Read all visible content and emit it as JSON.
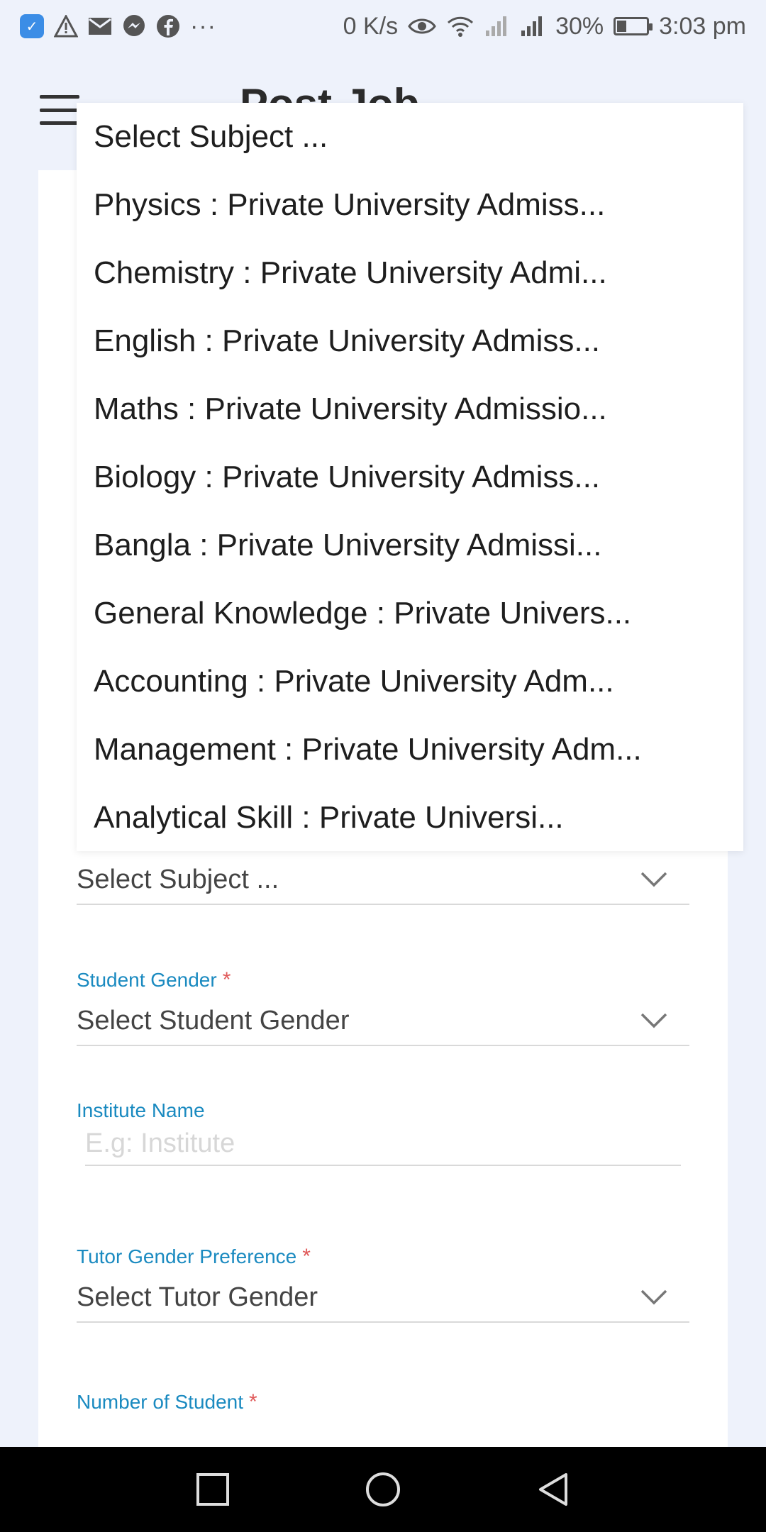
{
  "status_bar": {
    "net_speed": "0 K/s",
    "battery_percent": "30%",
    "time": "3:03 pm",
    "more": "···"
  },
  "header": {
    "title": "Post Job"
  },
  "dropdown": {
    "items": [
      "Select Subject ...",
      "Physics : Private University Admiss...",
      "Chemistry : Private University Admi...",
      "English : Private University Admiss...",
      "Maths : Private University Admissio...",
      "Biology : Private University Admiss...",
      "Bangla : Private University Admissi...",
      "General Knowledge : Private Univers...",
      "Accounting : Private University Adm...",
      "Management : Private University Adm...",
      "Analytical Skill : Private Universi..."
    ]
  },
  "form": {
    "subject": {
      "value": "Select Subject ..."
    },
    "student_gender": {
      "label": "Student Gender",
      "required": "*",
      "value": "Select Student Gender"
    },
    "institute": {
      "label": "Institute Name",
      "placeholder": "E.g: Institute"
    },
    "tutor_gender": {
      "label": "Tutor Gender Preference",
      "required": "*",
      "value": "Select Tutor Gender"
    },
    "num_students": {
      "label": "Number of Student",
      "required": "*"
    }
  },
  "colors": {
    "accent_label": "#1a8ac0",
    "required": "#e05a5a",
    "background": "#eef2fb"
  }
}
